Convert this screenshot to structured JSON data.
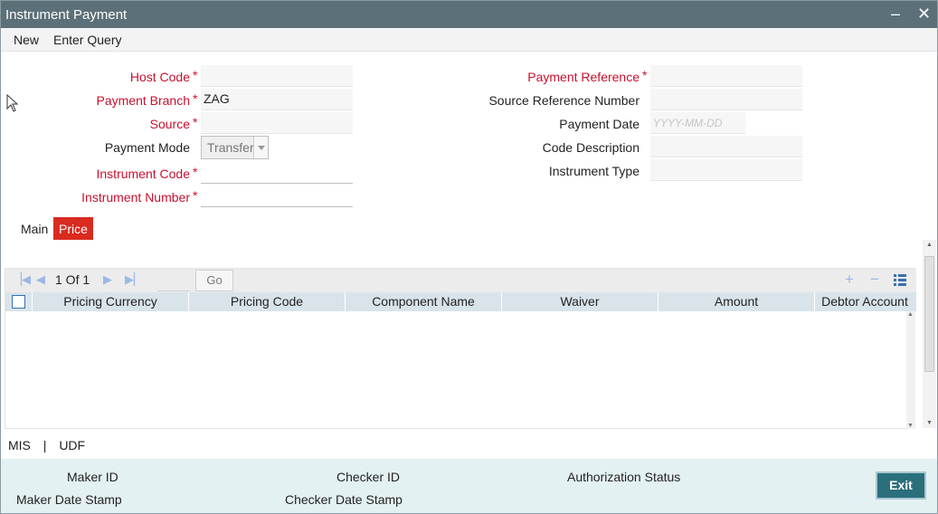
{
  "window": {
    "title": "Instrument Payment",
    "minimize": "–",
    "close": "✕"
  },
  "menu": {
    "new": "New",
    "enter_query": "Enter Query"
  },
  "form": {
    "host_code": {
      "label": "Host Code",
      "value": ""
    },
    "payment_branch": {
      "label": "Payment Branch",
      "value": "ZAG"
    },
    "source": {
      "label": "Source",
      "value": ""
    },
    "payment_mode": {
      "label": "Payment Mode",
      "value": "Transfer"
    },
    "instrument_code": {
      "label": "Instrument Code",
      "value": ""
    },
    "instrument_number": {
      "label": "Instrument Number",
      "value": ""
    },
    "payment_reference": {
      "label": "Payment Reference",
      "value": ""
    },
    "source_reference_number": {
      "label": "Source Reference Number",
      "value": ""
    },
    "payment_date": {
      "label": "Payment Date",
      "placeholder": "YYYY-MM-DD"
    },
    "code_description": {
      "label": "Code Description",
      "value": ""
    },
    "instrument_type": {
      "label": "Instrument Type",
      "value": ""
    },
    "required_marker": "*"
  },
  "tabs": [
    {
      "label": "Main",
      "active": false
    },
    {
      "label": "Price",
      "active": true
    }
  ],
  "grid": {
    "pager": "1 Of 1",
    "go": "Go",
    "columns": [
      "Pricing Currency",
      "Pricing Code",
      "Component Name",
      "Waiver",
      "Amount",
      "Debtor Account"
    ],
    "rows": []
  },
  "links": {
    "mis": "MIS",
    "sep": "|",
    "udf": "UDF"
  },
  "footer": {
    "maker_id": "Maker ID",
    "maker_date_stamp": "Maker Date Stamp",
    "checker_id": "Checker ID",
    "checker_date_stamp": "Checker Date Stamp",
    "authorization_status": "Authorization Status",
    "exit": "Exit"
  },
  "colors": {
    "title_bar": "#5b7078",
    "required": "#c8102e",
    "active_tab": "#d92b1f",
    "exit_button": "#2a6f7c"
  }
}
